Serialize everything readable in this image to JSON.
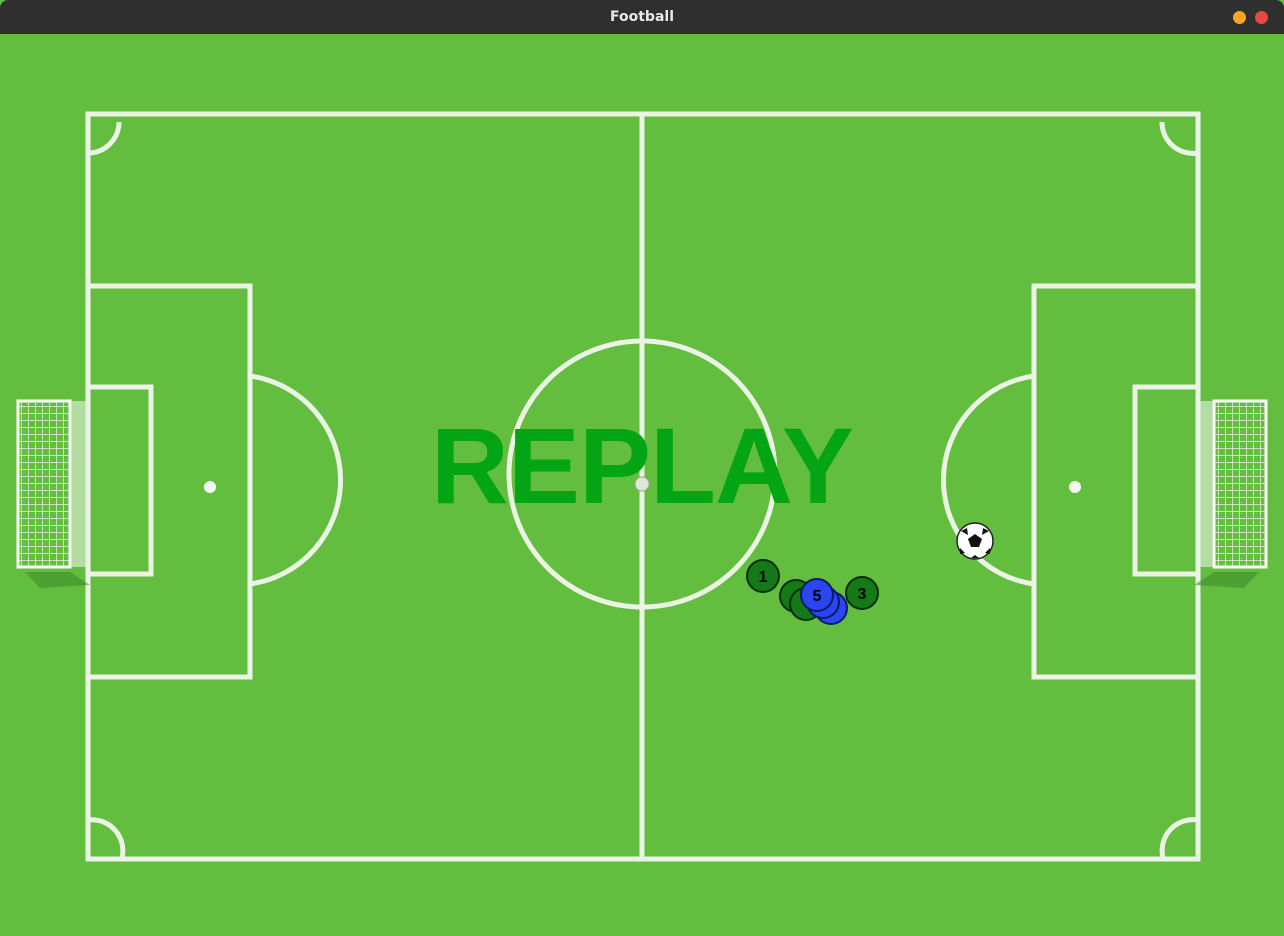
{
  "window": {
    "title": "Football"
  },
  "overlay": {
    "text": "REPLAY"
  },
  "colors": {
    "grass": "#63bd3f",
    "lines": "#ebf3e5",
    "team_green": "#137a17",
    "team_blue": "#2a46f0",
    "replay_text": "#04a514"
  },
  "players": [
    {
      "team": "green",
      "number": "1"
    },
    {
      "team": "green",
      "number": ""
    },
    {
      "team": "green",
      "number": ""
    },
    {
      "team": "green",
      "number": "3"
    },
    {
      "team": "blue",
      "number": ""
    },
    {
      "team": "blue",
      "number": ""
    },
    {
      "team": "blue",
      "number": "5"
    }
  ],
  "ball": {
    "icon": "soccer-ball-icon"
  }
}
